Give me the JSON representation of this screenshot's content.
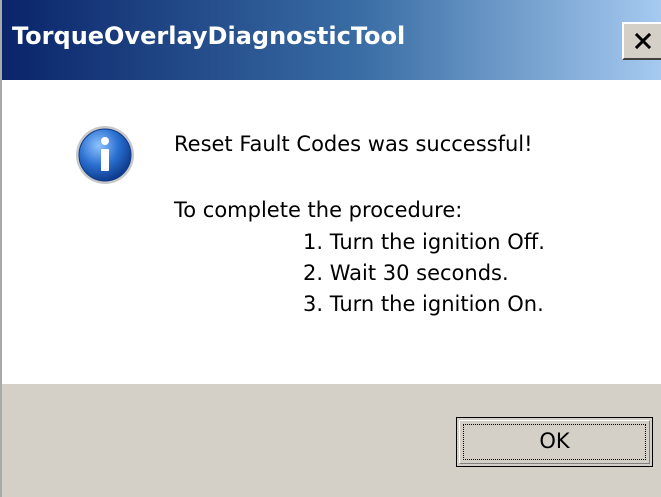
{
  "window": {
    "title": "TorqueOverlayDiagnosticTool",
    "close_icon": "close-icon"
  },
  "message": {
    "icon": "info-icon",
    "headline": "Reset Fault Codes was successful!",
    "procedure_intro": "To complete the procedure:",
    "steps": [
      "1. Turn the ignition Off.",
      "2. Wait 30 seconds.",
      "3. Turn the ignition On."
    ]
  },
  "buttons": {
    "ok_label": "OK"
  },
  "colors": {
    "title_gradient_start": "#0a246a",
    "title_gradient_end": "#a6caf0",
    "button_face": "#d4d0c8",
    "icon_blue": "#1c5fb8"
  }
}
